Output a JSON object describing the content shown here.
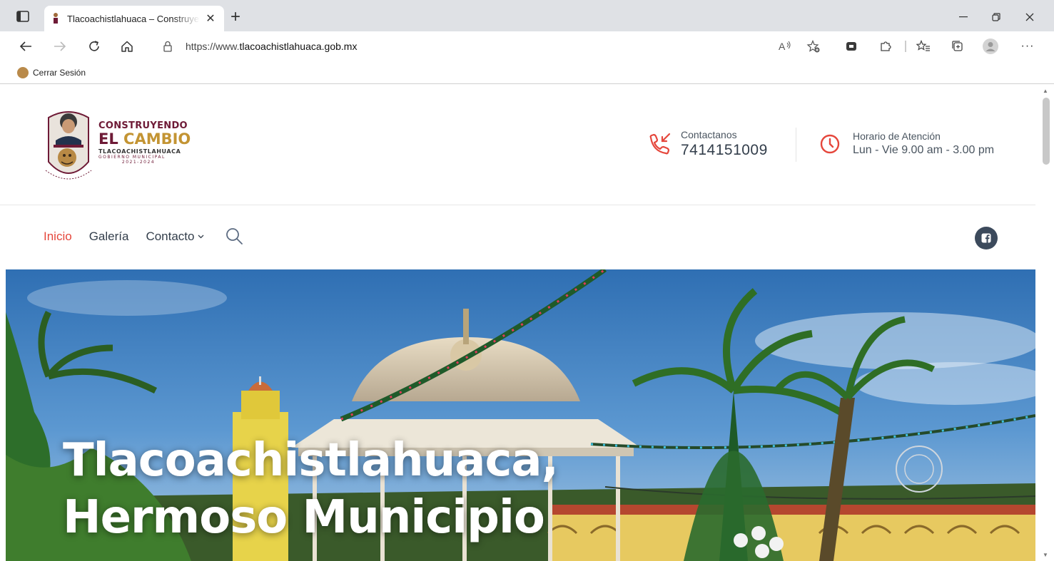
{
  "browser": {
    "tab_title": "Tlacoachistlahuaca – Construyendo el Cambio",
    "url_prefix": "https://www.",
    "url_domain": "tlacoachistlahuaca.gob.mx",
    "favorites": [
      {
        "label": "Cerrar Sesión"
      }
    ]
  },
  "header": {
    "logo": {
      "line1": "CONSTRUYENDO",
      "line2a": "EL ",
      "line2b": "CAMBIO",
      "line3": "TLACOACHISTLAHUACA",
      "line4": "GOBIERNO MUNICIPAL",
      "line5": "2021-2024"
    },
    "contact_label": "Contactanos",
    "contact_phone": "7414151009",
    "hours_label": "Horario de Atención",
    "hours_value": "Lun - Vie 9.00 am - 3.00 pm"
  },
  "nav": {
    "items": [
      {
        "label": "Inicio"
      },
      {
        "label": "Galería"
      },
      {
        "label": "Contacto"
      }
    ]
  },
  "hero": {
    "line1": "Tlacoachistlahuaca,",
    "line2": "Hermoso Municipio"
  },
  "colors": {
    "accent_red": "#e5473c",
    "nav_text": "#333e4b",
    "logo_maroon": "#6e1a36",
    "logo_gold": "#c39433"
  }
}
